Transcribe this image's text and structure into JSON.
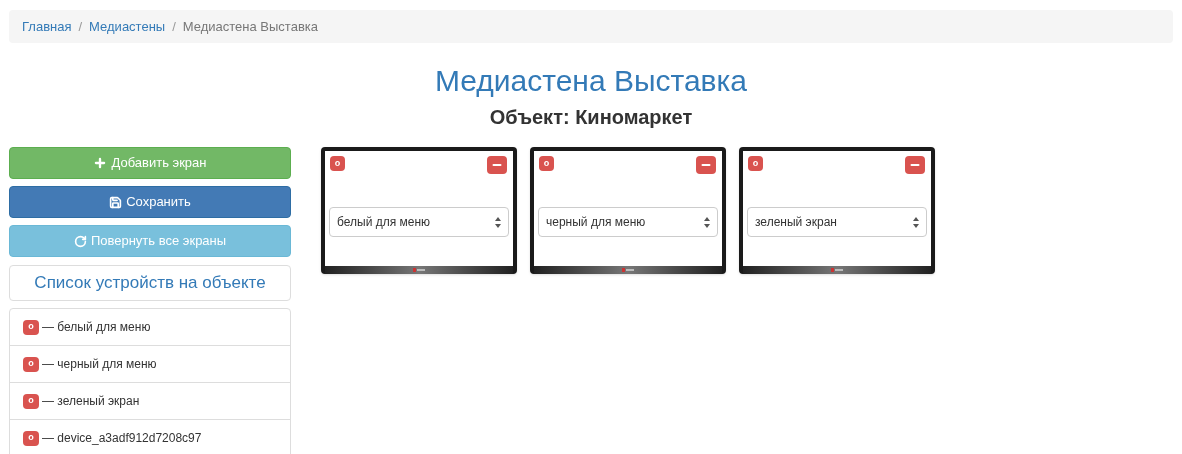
{
  "breadcrumb": [
    {
      "label": "Главная",
      "kind": "link"
    },
    {
      "label": "/",
      "kind": "separator"
    },
    {
      "label": "Медиастены",
      "kind": "link"
    },
    {
      "label": "/",
      "kind": "separator"
    },
    {
      "label": "Медиастена Выставка",
      "kind": "current"
    }
  ],
  "title": "Медиастена Выставка",
  "subtitle": "Объект: Киномаркет",
  "buttons": [
    {
      "label": "Добавить экран",
      "kind": "add"
    },
    {
      "label": "Сохранить",
      "kind": "save"
    },
    {
      "label": "Повернуть все экраны",
      "kind": "rotate"
    }
  ],
  "device_list": {
    "title": "Список устройств на объекте",
    "items": [
      {
        "badge": "o",
        "label": "— белый для меню"
      },
      {
        "badge": "o",
        "label": "— черный для меню"
      },
      {
        "badge": "o",
        "label": "— зеленый экран"
      },
      {
        "badge": "o",
        "label": "— device_a3adf912d7208c97"
      }
    ]
  },
  "screens": [
    {
      "badge": "o",
      "value": "белый для меню"
    },
    {
      "badge": "o",
      "value": "черный для меню"
    },
    {
      "badge": "o",
      "value": "зеленый экран"
    }
  ]
}
